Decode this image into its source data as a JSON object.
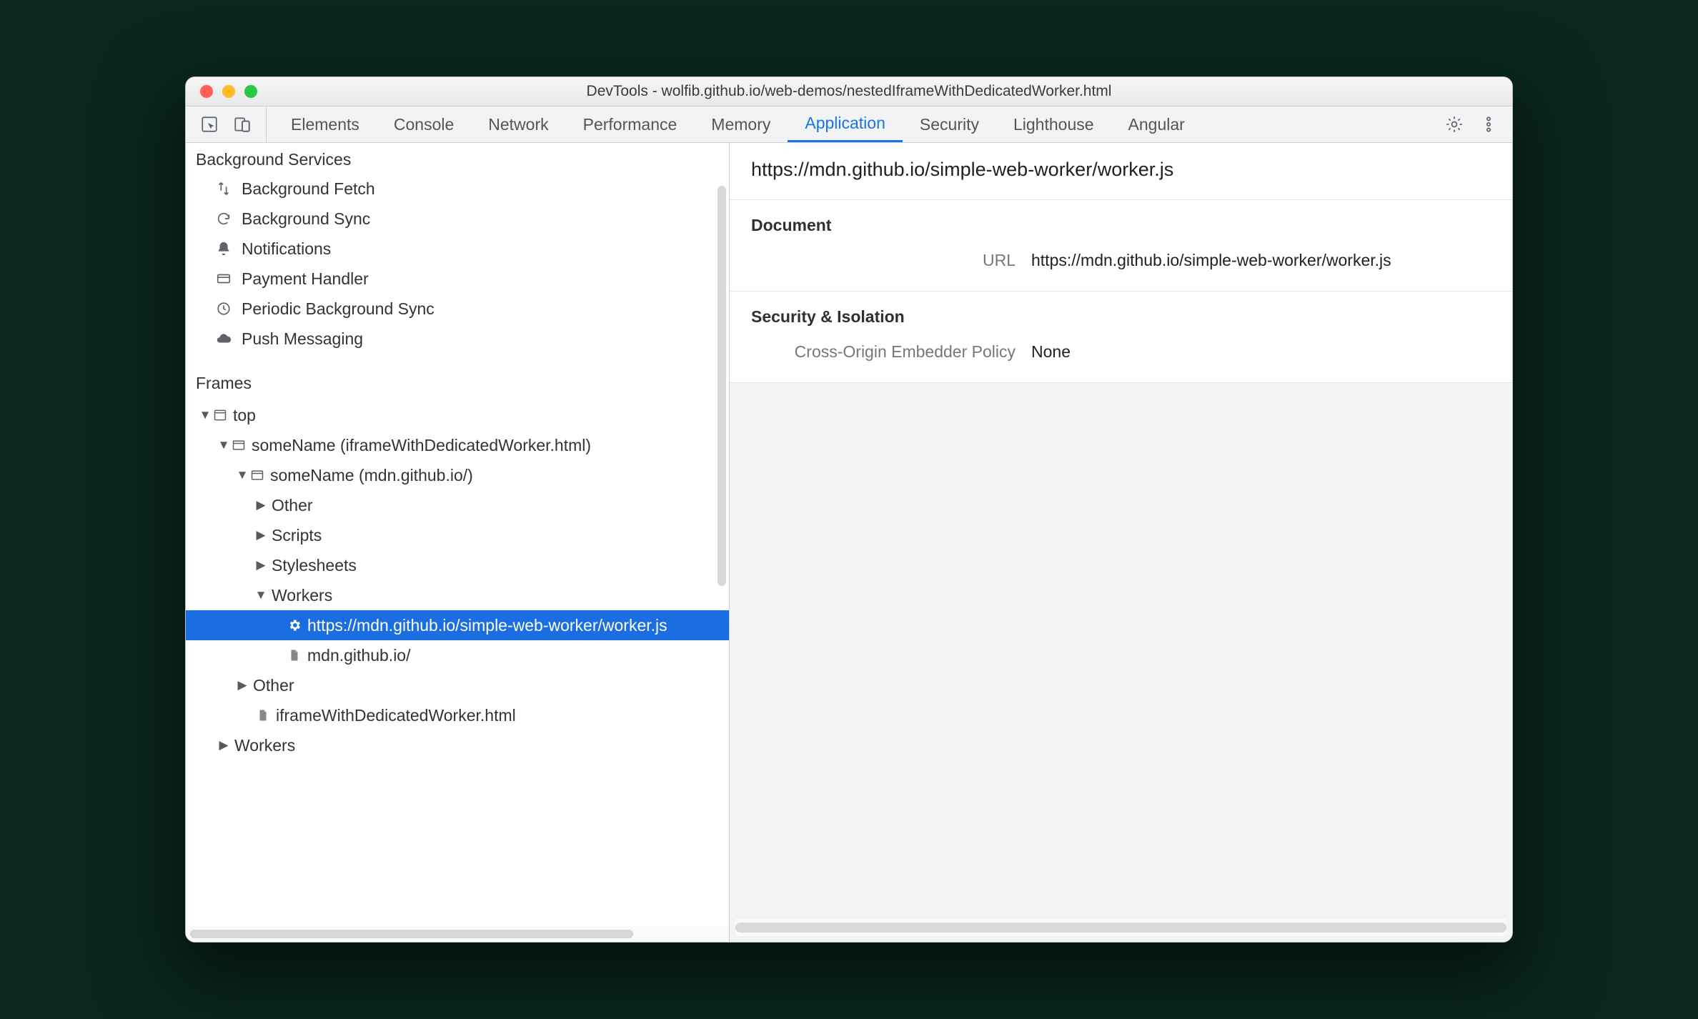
{
  "window": {
    "title": "DevTools - wolfib.github.io/web-demos/nestedIframeWithDedicatedWorker.html"
  },
  "tabs": {
    "items": [
      "Elements",
      "Console",
      "Network",
      "Performance",
      "Memory",
      "Application",
      "Security",
      "Lighthouse",
      "Angular"
    ],
    "activeIndex": 5
  },
  "sidebar": {
    "sections": {
      "background": {
        "title": "Background Services",
        "items": [
          {
            "icon": "updown",
            "label": "Background Fetch"
          },
          {
            "icon": "sync",
            "label": "Background Sync"
          },
          {
            "icon": "bell",
            "label": "Notifications"
          },
          {
            "icon": "card",
            "label": "Payment Handler"
          },
          {
            "icon": "clock",
            "label": "Periodic Background Sync"
          },
          {
            "icon": "cloud",
            "label": "Push Messaging"
          }
        ]
      },
      "frames": {
        "title": "Frames"
      }
    },
    "tree": {
      "top": "top",
      "f1": "someName (iframeWithDedicatedWorker.html)",
      "f2": "someName (mdn.github.io/)",
      "other": "Other",
      "scripts": "Scripts",
      "stylesheets": "Stylesheets",
      "workers": "Workers",
      "workerUrl": "https://mdn.github.io/simple-web-worker/worker.js",
      "doc1": "mdn.github.io/",
      "other2": "Other",
      "doc2": "iframeWithDedicatedWorker.html",
      "workers2": "Workers"
    }
  },
  "detail": {
    "heading": "https://mdn.github.io/simple-web-worker/worker.js",
    "document": {
      "title": "Document",
      "urlLabel": "URL",
      "urlValue": "https://mdn.github.io/simple-web-worker/worker.js"
    },
    "security": {
      "title": "Security & Isolation",
      "coepLabel": "Cross-Origin Embedder Policy",
      "coepValue": "None"
    }
  }
}
